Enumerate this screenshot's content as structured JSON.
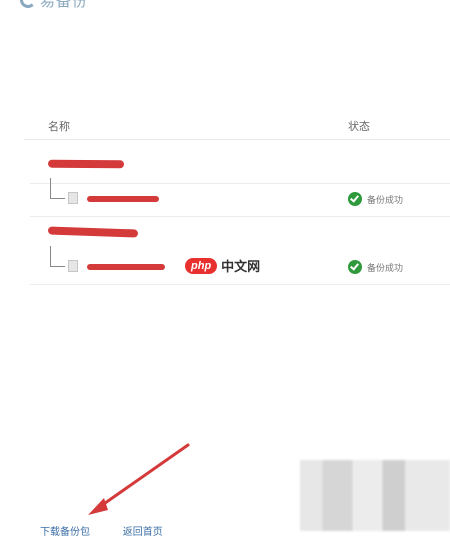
{
  "header": {
    "logo_text": "易备份"
  },
  "table": {
    "columns": [
      "名称",
      "状态"
    ]
  },
  "groups": [
    {
      "status": "备份成功",
      "status_color": "#2e9a3c"
    },
    {
      "status": "备份成功",
      "status_color": "#2e9a3c"
    }
  ],
  "watermark": {
    "badge": "php",
    "text": "中文网"
  },
  "bottom": {
    "link1": "下载备份包",
    "link2": "返回首页"
  },
  "colors": {
    "redaction": "#d43a3a",
    "link": "#3a6ea5",
    "accent": "#8aa9bf"
  }
}
